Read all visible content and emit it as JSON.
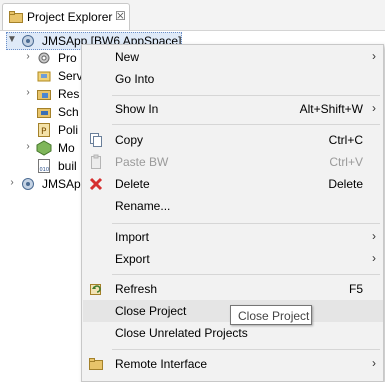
{
  "view": {
    "tab_title": "Project Explorer",
    "close_glyph": "☒"
  },
  "tree": {
    "items": [
      {
        "label": "JMSApp  [BW6 AppSpace]",
        "icon": "bw-app-icon",
        "expanded": true
      },
      {
        "label": "Pro",
        "icon": "process-gear-icon"
      },
      {
        "label": "Serv",
        "icon": "service-icon"
      },
      {
        "label": "Res",
        "icon": "resources-folder-icon"
      },
      {
        "label": "Sch",
        "icon": "schemas-folder-icon"
      },
      {
        "label": "Poli",
        "icon": "policies-icon"
      },
      {
        "label": "Mo",
        "icon": "module-icon"
      },
      {
        "label": "buil",
        "icon": "build-file-icon"
      },
      {
        "label": "JMSAp",
        "icon": "bw-app-icon"
      }
    ]
  },
  "menu": {
    "items": [
      {
        "label": "New",
        "shortcut": "",
        "submenu": true
      },
      {
        "label": "Go Into",
        "shortcut": "",
        "submenu": false
      },
      {
        "label": "Show In",
        "shortcut": "Alt+Shift+W",
        "submenu": true
      },
      {
        "label": "Copy",
        "shortcut": "Ctrl+C",
        "icon": "copy-icon"
      },
      {
        "label": "Paste BW",
        "shortcut": "Ctrl+V",
        "icon": "paste-icon",
        "disabled": true
      },
      {
        "label": "Delete",
        "shortcut": "Delete",
        "icon": "delete-red-x-icon"
      },
      {
        "label": "Rename...",
        "shortcut": ""
      },
      {
        "label": "Import",
        "shortcut": "",
        "submenu": true
      },
      {
        "label": "Export",
        "shortcut": "",
        "submenu": true
      },
      {
        "label": "Refresh",
        "shortcut": "F5",
        "icon": "refresh-icon"
      },
      {
        "label": "Close Project",
        "shortcut": "",
        "hovered": true
      },
      {
        "label": "Close Unrelated Projects",
        "shortcut": ""
      },
      {
        "label": "Remote Interface",
        "shortcut": "",
        "icon": "folder-icon",
        "submenu": true
      }
    ],
    "submenu_glyph": "›"
  },
  "tooltip": {
    "text": "Close Project"
  },
  "colors": {
    "selection": "#dfeaf8",
    "menu_bg": "#f2f2f2",
    "hover_bg": "#e5e5e5",
    "delete_red": "#d62f2f"
  }
}
